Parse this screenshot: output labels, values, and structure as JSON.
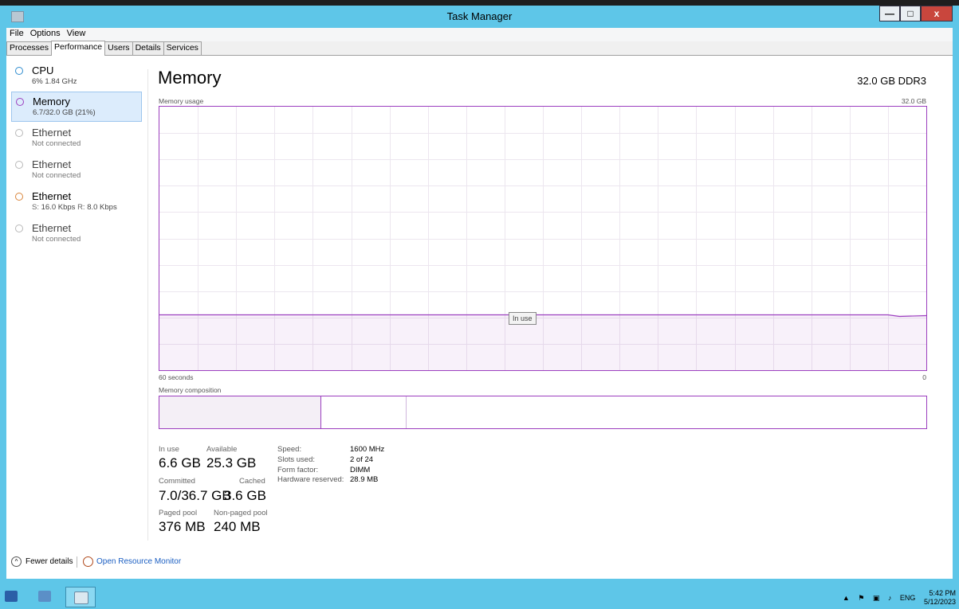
{
  "window": {
    "title": "Task Manager"
  },
  "menu": [
    "File",
    "Options",
    "View"
  ],
  "tabs": [
    "Processes",
    "Performance",
    "Users",
    "Details",
    "Services"
  ],
  "active_tab": "Performance",
  "sidebar": {
    "items": [
      {
        "name": "CPU",
        "sub": "6% 1.84 GHz",
        "color": "#2e8ccf"
      },
      {
        "name": "Memory",
        "sub": "6.7/32.0 GB (21%)",
        "color": "#9c3fbf"
      },
      {
        "name": "Ethernet",
        "sub": "Not connected",
        "color": "#b8b8b8"
      },
      {
        "name": "Ethernet",
        "sub": "Not connected",
        "color": "#b8b8b8"
      },
      {
        "name": "Ethernet",
        "sub_send_label": "S:",
        "sub_send": "16.0 Kbps",
        "sub_recv_label": "R:",
        "sub_recv": "8.0 Kbps",
        "color": "#d9853b"
      },
      {
        "name": "Ethernet",
        "sub": "Not connected",
        "color": "#b8b8b8"
      }
    ],
    "selected_index": 1
  },
  "main": {
    "title": "Memory",
    "spec": "32.0 GB DDR3",
    "graph": {
      "label": "Memory usage",
      "max_label": "32.0 GB",
      "time_label": "60 seconds",
      "min_label": "0",
      "tooltip": "In use",
      "usage_fraction": 0.21
    },
    "composition_label": "Memory composition",
    "stats": {
      "in_use_label": "In use",
      "in_use": "6.6 GB",
      "available_label": "Available",
      "available": "25.3 GB",
      "committed_label": "Committed",
      "committed": "7.0/36.7 GB",
      "cached_label": "Cached",
      "cached": "3.6 GB",
      "paged_label": "Paged pool",
      "paged": "376 MB",
      "nonpaged_label": "Non-paged pool",
      "nonpaged": "240 MB"
    },
    "details": [
      {
        "key": "Speed:",
        "value": "1600 MHz"
      },
      {
        "key": "Slots used:",
        "value": "2 of 24"
      },
      {
        "key": "Form factor:",
        "value": "DIMM"
      },
      {
        "key": "Hardware reserved:",
        "value": "28.9 MB"
      }
    ]
  },
  "footer": {
    "fewer_details": "Fewer details",
    "resource_monitor": "Open Resource Monitor"
  },
  "taskbar": {
    "tray_lang": "ENG",
    "time": "5:42 PM",
    "date": "5/12/2023"
  },
  "colors": {
    "memory_accent": "#9c3fbf",
    "titlebar": "#5ec6e8"
  }
}
